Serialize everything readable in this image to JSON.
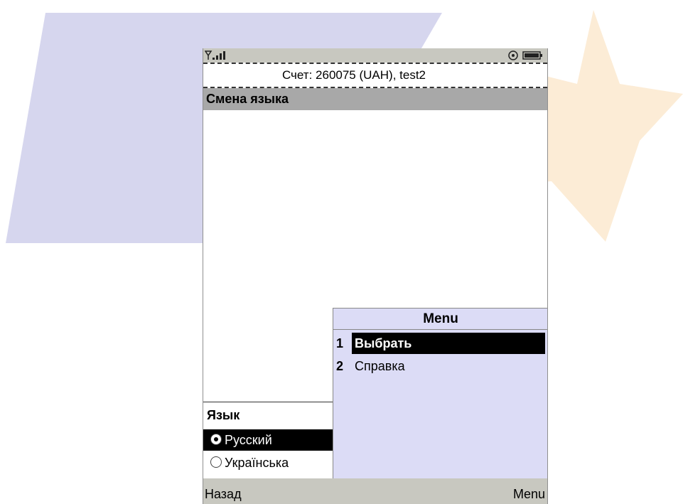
{
  "status_bar": {
    "signal_icon": "signal-strength-icon",
    "settings_icon": "gear-icon",
    "battery_icon": "battery-icon"
  },
  "account": {
    "text": "Счет: 260075 (UAH), test2"
  },
  "screen": {
    "title": "Смена языка"
  },
  "language": {
    "label": "Язык",
    "options": [
      {
        "text": "Русский",
        "selected": true
      },
      {
        "text": "Українська",
        "selected": false
      }
    ]
  },
  "menu": {
    "title": "Menu",
    "items": [
      {
        "number": "1",
        "label": "Выбрать",
        "highlighted": true
      },
      {
        "number": "2",
        "label": "Справка",
        "highlighted": false
      }
    ]
  },
  "softkeys": {
    "left": "Назад",
    "right": "Menu"
  },
  "colors": {
    "menu_bg": "#dcdcf6",
    "title_bg": "#a8a8a8",
    "bar_bg": "#c8c8c0",
    "highlight": "#000000"
  }
}
